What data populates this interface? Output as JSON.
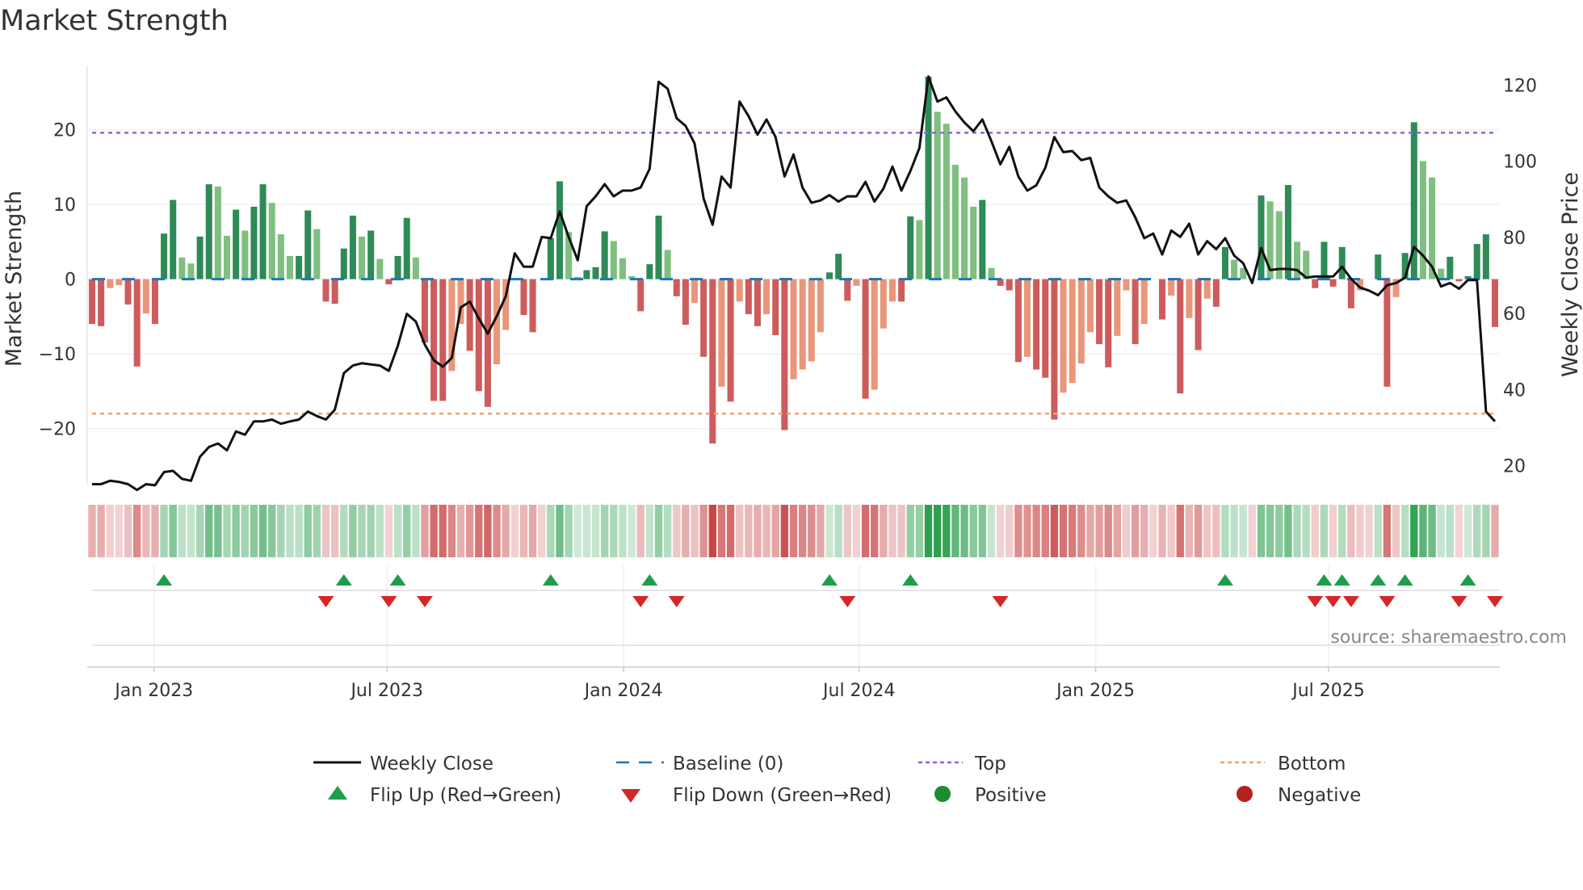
{
  "chart_data": {
    "type": "bar",
    "title": "Market Strength",
    "ylabel": "Market Strength",
    "y2label": "Weekly Close Price",
    "ylim": [
      -27.5,
      28.5
    ],
    "y2lim": [
      15,
      125
    ],
    "yticks": [
      {
        "v": 20,
        "label": "20"
      },
      {
        "v": 10,
        "label": "10"
      },
      {
        "v": 0,
        "label": "0"
      },
      {
        "v": -10,
        "label": "−10"
      },
      {
        "v": -20,
        "label": "−20"
      }
    ],
    "y2ticks": [
      {
        "v": 20,
        "label": "20"
      },
      {
        "v": 40,
        "label": "40"
      },
      {
        "v": 60,
        "label": "60"
      },
      {
        "v": 80,
        "label": "80"
      },
      {
        "v": 100,
        "label": "100"
      },
      {
        "v": 120,
        "label": "120"
      }
    ],
    "xticks": [
      {
        "week": 6.9,
        "label": "Jan 2023"
      },
      {
        "week": 32.8,
        "label": "Jul 2023"
      },
      {
        "week": 59.1,
        "label": "Jan 2024"
      },
      {
        "week": 85.3,
        "label": "Jul 2024"
      },
      {
        "week": 111.6,
        "label": "Jan 2025"
      },
      {
        "week": 137.5,
        "label": "Jul 2025"
      }
    ],
    "top_level": 19.6,
    "bottom_level": -18,
    "baseline": 0,
    "strength": [
      -6,
      -6.3,
      -1.2,
      -0.8,
      -3.4,
      -11.7,
      -4.6,
      -6,
      6.1,
      10.6,
      2.9,
      2.1,
      5.7,
      12.7,
      12.4,
      5.8,
      9.3,
      6.5,
      9.7,
      12.7,
      10.2,
      6.0,
      3.1,
      3.1,
      9.2,
      6.7,
      -3,
      -3.3,
      4.1,
      8.5,
      5.7,
      6.5,
      2.7,
      -0.7,
      3.1,
      8.2,
      2.9,
      -8.5,
      -16.3,
      -16.3,
      -12.3,
      -6,
      -9.6,
      -15,
      -17.1,
      -11.4,
      -6.8,
      0,
      -4.8,
      -7.1,
      0,
      5.5,
      13.1,
      6.3,
      0.3,
      1.2,
      1.6,
      6.4,
      5.1,
      2.8,
      0.4,
      -4.3,
      2.0,
      8.5,
      3.9,
      -2.3,
      -6.1,
      -3.2,
      -10.4,
      -22,
      -14.4,
      -16.4,
      -3.0,
      -4.7,
      -6.3,
      -4.7,
      -7.5,
      -20.2,
      -13.4,
      -12.1,
      -11.0,
      -7.1,
      0.9,
      3.4,
      -2.9,
      -0.9,
      -16,
      -14.8,
      -6.6,
      -3.0,
      -3.0,
      8.4,
      7.9,
      27.1,
      22.4,
      20.8,
      15.3,
      13.6,
      9.7,
      10.6,
      1.5,
      -0.9,
      -1.5,
      -11.1,
      -10.4,
      -12.1,
      -13.2,
      -18.8,
      -15.2,
      -13.9,
      -11.3,
      -7.1,
      -8.7,
      -11.8,
      -7.6,
      -1.5,
      -8.7,
      -6.0,
      0,
      -5.4,
      -2.2,
      -15.3,
      -5.2,
      -9.5,
      -2.6,
      -3.7,
      4.3,
      2.6,
      1.5,
      0,
      11.2,
      10.4,
      9.1,
      12.6,
      5.0,
      3.8,
      -1.2,
      5.0,
      -1.0,
      4.3,
      -3.9,
      -1.5,
      0,
      3.3,
      -14.4,
      -2.4,
      3.5,
      21.0,
      15.8,
      13.6,
      1.4,
      3.0,
      -0.3,
      0.4,
      4.7,
      6.0,
      -6.4
    ],
    "weekly_close": [
      15.1,
      15.1,
      16.0,
      15.7,
      15.1,
      13.6,
      15.1,
      14.8,
      18.3,
      18.6,
      16.5,
      16.0,
      22.3,
      24.9,
      25.8,
      24.0,
      29.0,
      28.1,
      31.6,
      31.6,
      32.1,
      31.0,
      31.6,
      32.1,
      34.2,
      33.0,
      32.1,
      34.7,
      44.3,
      46.3,
      46.9,
      46.6,
      46.3,
      44.9,
      51.5,
      59.9,
      57.9,
      51.8,
      47.7,
      46.0,
      48.3,
      61.6,
      63.1,
      58.7,
      54.7,
      59.3,
      64.5,
      75.8,
      72.3,
      72.3,
      80.1,
      79.8,
      86.8,
      80.1,
      74.0,
      88.2,
      90.8,
      94.0,
      90.8,
      92.3,
      92.3,
      93.1,
      98.0,
      120.9,
      119.1,
      111.3,
      109.3,
      104.7,
      90.2,
      83.3,
      96.0,
      93.1,
      115.7,
      111.9,
      107.0,
      111.0,
      106.4,
      96.0,
      101.8,
      93.1,
      89.1,
      89.7,
      91.1,
      89.4,
      90.8,
      90.8,
      94.6,
      89.4,
      92.8,
      98.6,
      92.3,
      97.5,
      103.5,
      122.3,
      115.7,
      116.8,
      113.1,
      110.2,
      107.9,
      111.0,
      105.3,
      99.2,
      103.8,
      96.0,
      92.3,
      93.7,
      98.3,
      106.4,
      102.4,
      102.7,
      100.3,
      100.9,
      93.1,
      90.8,
      89.1,
      89.7,
      85.3,
      79.8,
      81.0,
      75.5,
      81.8,
      80.1,
      83.6,
      75.5,
      79.0,
      76.9,
      79.8,
      75.2,
      73.2,
      68.0,
      77.2,
      71.4,
      71.7,
      71.7,
      71.4,
      69.4,
      69.7,
      69.7,
      69.7,
      72.3,
      69.1,
      66.8,
      66.0,
      64.8,
      67.4,
      68.0,
      69.4,
      77.5,
      75.2,
      72.3,
      67.1,
      68.0,
      66.5,
      68.8,
      68.8,
      34.2,
      31.6
    ],
    "colors": {
      "pos_strong": "#2e8b57",
      "pos_weak": "#7fbf7f",
      "neg_strong": "#cd5c5c",
      "neg_weak": "#e9967a",
      "baseline": "#1f77b4",
      "top": "#9b5fd6",
      "bottom": "#f4a261",
      "line": "#111111",
      "flip_up": "#1e9e4a",
      "flip_down": "#d62728",
      "positive": "#1e8c2e",
      "negative": "#b22222"
    },
    "legend": {
      "weekly_close": "Weekly Close",
      "baseline": "Baseline (0)",
      "top": "Top",
      "bottom": "Bottom",
      "flip_up": "Flip Up (Red→Green)",
      "flip_down": "Flip Down (Green→Red)",
      "positive": "Positive",
      "negative": "Negative"
    },
    "source": "source: sharemaestro.com"
  }
}
